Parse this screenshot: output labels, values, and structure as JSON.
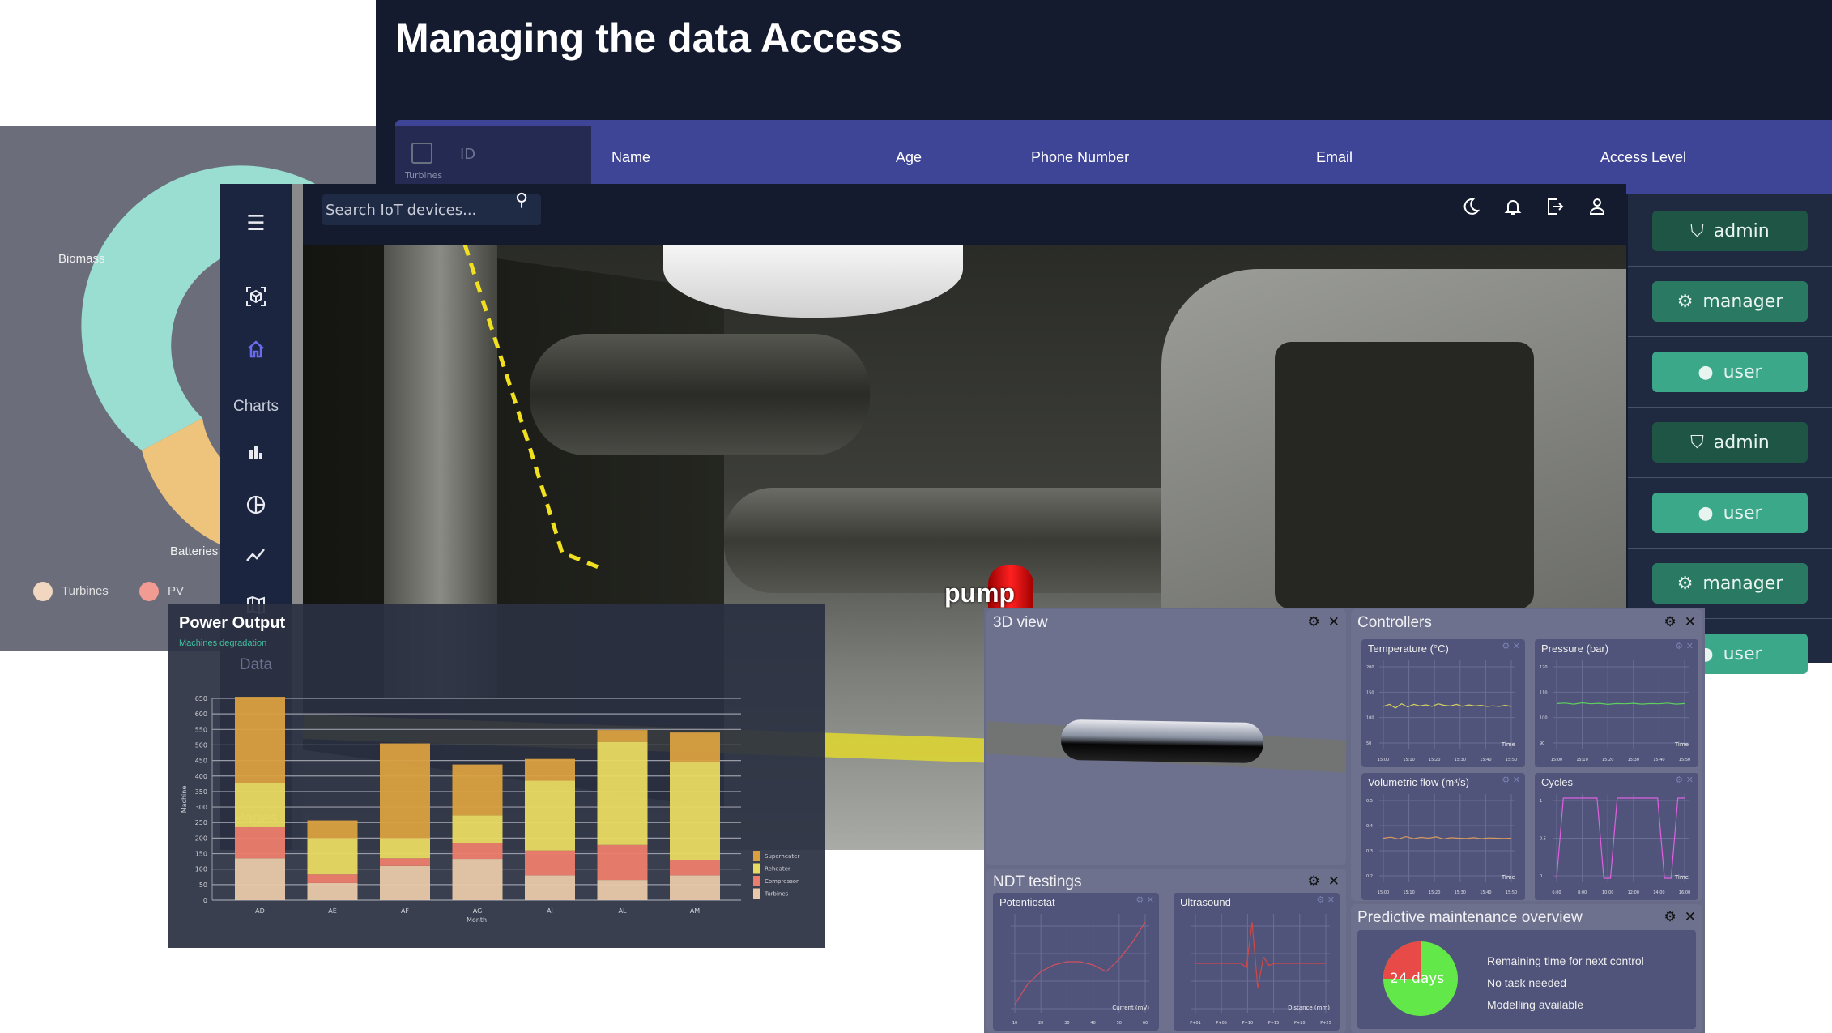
{
  "page_title": "Managing the data Access",
  "table": {
    "id_header": "ID",
    "columns": [
      "Name",
      "Age",
      "Phone Number",
      "Email",
      "Access Level"
    ],
    "clipped_label": "Turbines",
    "roles": [
      {
        "label": "admin",
        "icon": "shield-user-icon",
        "color": "#1f5545"
      },
      {
        "label": "manager",
        "icon": "user-gear-icon",
        "color": "#2a7a63"
      },
      {
        "label": "user",
        "icon": "user-circle-icon",
        "color": "#3ba88a"
      },
      {
        "label": "admin",
        "icon": "shield-user-icon",
        "color": "#1f5545"
      },
      {
        "label": "user",
        "icon": "user-circle-icon",
        "color": "#3ba88a"
      },
      {
        "label": "manager",
        "icon": "user-gear-icon",
        "color": "#2a7a63"
      },
      {
        "label": "user",
        "icon": "user-circle-icon",
        "color": "#3ba88a"
      }
    ]
  },
  "energy_pie": {
    "labels": {
      "biomass": "Biomass",
      "batteries": "Batteries"
    },
    "legend": [
      "Turbines",
      "PV"
    ],
    "colors": {
      "Biomass": "#9addd1",
      "Batteries": "#eec47c",
      "Turbines": "#f1d6c0",
      "PV": "#f19b92"
    }
  },
  "dashboard": {
    "search_placeholder": "Search IoT devices...",
    "sidebar": {
      "charts_label": "Charts",
      "data_label": "Data",
      "pages_label": "Pages"
    },
    "scene_label": "pump",
    "accent": "#6a6cf0"
  },
  "chart_data": {
    "type": "bar",
    "stacked": true,
    "title": "Power Output",
    "subtitle": "Machines degradation",
    "xlabel": "Month",
    "ylabel": "Machine",
    "ylim": [
      0,
      650
    ],
    "yticks": [
      0,
      50,
      100,
      150,
      200,
      250,
      300,
      350,
      400,
      450,
      500,
      550,
      600,
      650
    ],
    "categories": [
      "AD",
      "AE",
      "AF",
      "AG",
      "AI",
      "AL",
      "AM"
    ],
    "series": [
      {
        "name": "Turbines",
        "color": "#e8c8a8",
        "values": [
          135,
          55,
          110,
          133,
          80,
          65,
          80
        ]
      },
      {
        "name": "Compressor",
        "color": "#ec7d6c",
        "values": [
          100,
          28,
          25,
          52,
          80,
          113,
          48
        ]
      },
      {
        "name": "Reheater",
        "color": "#e9da62",
        "values": [
          143,
          117,
          65,
          88,
          225,
          332,
          317
        ]
      },
      {
        "name": "Superheater",
        "color": "#daa040",
        "values": [
          277,
          57,
          305,
          164,
          70,
          38,
          95
        ]
      }
    ],
    "legend": [
      "Superheater",
      "Reheater",
      "Compressor",
      "Turbines"
    ]
  },
  "widgets": {
    "view3d": {
      "title": "3D view"
    },
    "controllers": {
      "title": "Controllers",
      "charts": [
        {
          "title": "Temperature (°C)",
          "xlabel": "Time",
          "yticks": [
            "200",
            "150",
            "100",
            "50"
          ],
          "ylim": [
            40,
            210
          ],
          "xticks": [
            "15:00",
            "15:10",
            "15:20",
            "15:30",
            "15:40",
            "15:50"
          ],
          "color": "#d8d060",
          "values": [
            122,
            126,
            119,
            127,
            121,
            126,
            123,
            125,
            122,
            127,
            124,
            123,
            126,
            122,
            125,
            123,
            124,
            122,
            123,
            122,
            124,
            122
          ]
        },
        {
          "title": "Pressure (bar)",
          "xlabel": "Time",
          "yticks": [
            "120",
            "110",
            "100",
            "90"
          ],
          "ylim": [
            87,
            122
          ],
          "xticks": [
            "15:00",
            "15:10",
            "15:20",
            "15:30",
            "15:40",
            "15:50"
          ],
          "color": "#5ccf5c",
          "values": [
            105,
            105.2,
            104.8,
            105.3,
            104.9,
            105.1,
            104.7,
            105,
            104.9,
            105.1,
            104.8,
            105,
            104.9,
            105.2,
            104.8,
            105
          ]
        },
        {
          "title": "Volumetric flow (m³/s)",
          "xlabel": "Time",
          "yticks": [
            "0.5",
            "0.4",
            "0.3",
            "0.2"
          ],
          "ylim": [
            0.18,
            0.52
          ],
          "xticks": [
            "15:00",
            "15:10",
            "15:20",
            "15:30",
            "15:40",
            "15:50"
          ],
          "color": "#d89a60",
          "values": [
            0.35,
            0.354,
            0.347,
            0.356,
            0.348,
            0.353,
            0.35,
            0.355,
            0.347,
            0.352,
            0.35,
            0.349,
            0.352,
            0.348,
            0.351,
            0.35,
            0.349,
            0.35
          ]
        },
        {
          "title": "Cycles",
          "xlabel": "Time",
          "yticks": [
            "1",
            "0.5",
            "0"
          ],
          "ylim": [
            -0.05,
            1.05
          ],
          "xticks": [
            "6:00",
            "8:00",
            "10:00",
            "12:00",
            "14:00",
            "16:00"
          ],
          "color": "#e060e0",
          "values": [
            0,
            1,
            1,
            1,
            1,
            1,
            1,
            0,
            0,
            1,
            1,
            1,
            1,
            1,
            1,
            1,
            0,
            0,
            1,
            1
          ]
        }
      ]
    },
    "ndt": {
      "title": "NDT testings",
      "charts": [
        {
          "title": "Potentiostat",
          "xlabel": "Current (mV)",
          "xticks": [
            "10",
            "20",
            "30",
            "40",
            "50",
            "60"
          ],
          "ylim": [
            0,
            1.2
          ],
          "color": "#d05060",
          "values": [
            0.1,
            0.35,
            0.5,
            0.58,
            0.62,
            0.62,
            0.58,
            0.5,
            0.65,
            0.85,
            1.1
          ]
        },
        {
          "title": "Ultrasound",
          "xlabel": "Distance (mm)",
          "xticks": [
            "P+01",
            "P+05",
            "P+10",
            "P+15",
            "P+20",
            "P+25"
          ],
          "ylim": [
            -1.2,
            1.2
          ],
          "color": "#d04848",
          "values": [
            0,
            0,
            0,
            0,
            0,
            0,
            0,
            0,
            0,
            -0.1,
            1,
            -0.6,
            0.15,
            -0.05,
            0,
            0,
            0,
            0,
            0,
            0,
            0,
            0,
            0,
            0
          ]
        }
      ]
    },
    "predictive": {
      "title": "Predictive maintenance overview",
      "pie_label": "24 days",
      "remaining_fraction": 0.75,
      "colors": {
        "remaining": "#62e848",
        "elapsed": "#e84a48"
      },
      "lines": [
        "Remaining time for next control",
        "No task needed",
        "Modelling available"
      ]
    }
  }
}
